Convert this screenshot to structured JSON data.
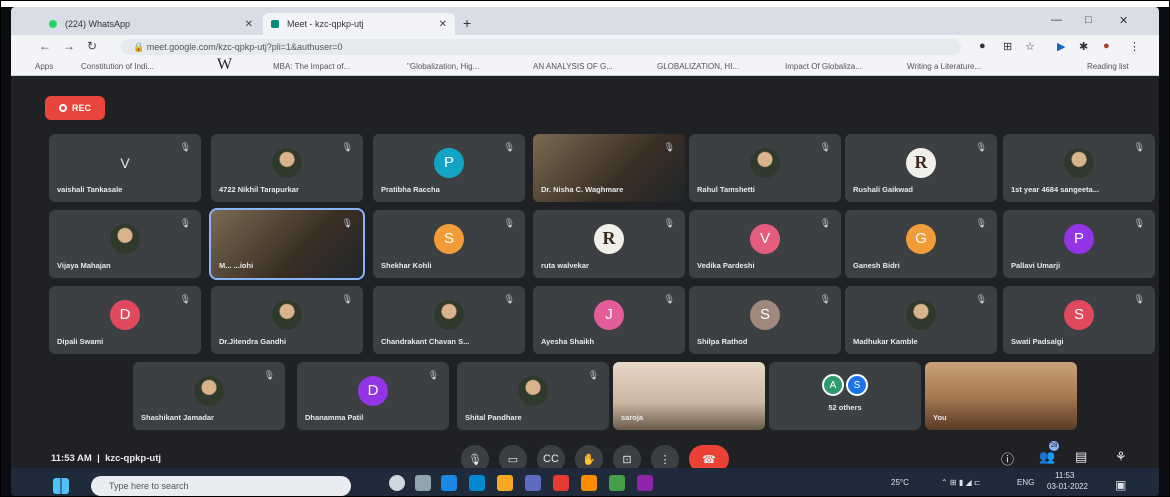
{
  "document_header_text": "",
  "browser": {
    "tabs": [
      {
        "label": "(224) WhatsApp",
        "icon": "whatsapp-icon",
        "color": "#25d366"
      },
      {
        "label": "Meet - kzc-qpkp-utj",
        "icon": "meet-icon",
        "color": "#00897b"
      }
    ],
    "new_tab": "+",
    "window_controls": [
      "—",
      "□",
      "✕"
    ],
    "url": "meet.google.com/kzc-qpkp-utj?pli=1&authuser=0",
    "bookmarks": [
      "Apps",
      "Constitution of Indi...",
      "W",
      "MBA: The Impact of...",
      "\"Globalization, Hig...",
      "AN ANALYSIS OF G...",
      "GLOBALIZATION, HI...",
      "Impact Of Globaliza...",
      "Writing a Literature...",
      "Reading list"
    ]
  },
  "meet": {
    "rec_label": "REC",
    "participants": [
      {
        "name": "vaishali Tankasale",
        "initial": "V",
        "kind": "plain"
      },
      {
        "name": "4722 Nikhil Tarapurkar",
        "initial": "",
        "kind": "photo"
      },
      {
        "name": "Pratibha Raccha",
        "initial": "P",
        "kind": "letter",
        "color": "#12a4c3"
      },
      {
        "name": "Dr. Nisha C. Waghmare",
        "initial": "",
        "kind": "video"
      },
      {
        "name": "Rahul Tamshetti",
        "initial": "",
        "kind": "photo"
      },
      {
        "name": "Rushali Gaikwad",
        "initial": "R",
        "kind": "logo"
      },
      {
        "name": "1st year 4684 sangeeta...",
        "initial": "",
        "kind": "photo"
      },
      {
        "name": "Vijaya Mahajan",
        "initial": "",
        "kind": "photo"
      },
      {
        "name": "M...   ...iohi",
        "initial": "",
        "kind": "video-active"
      },
      {
        "name": "Shekhar Kohli",
        "initial": "S",
        "kind": "letter",
        "color": "#f29c38"
      },
      {
        "name": "ruta walvekar",
        "initial": "R",
        "kind": "logo"
      },
      {
        "name": "Vedika Pardeshi",
        "initial": "V",
        "kind": "letter",
        "color": "#e45d7d"
      },
      {
        "name": "Ganesh Bidri",
        "initial": "G",
        "kind": "letter",
        "color": "#f29c38"
      },
      {
        "name": "Pallavi Umarji",
        "initial": "P",
        "kind": "letter",
        "color": "#9334e6"
      },
      {
        "name": "Dipali Swami",
        "initial": "D",
        "kind": "letter",
        "color": "#e0485e"
      },
      {
        "name": "Dr.Jitendra Gandhi",
        "initial": "",
        "kind": "photo"
      },
      {
        "name": "Chandrakant Chavan S...",
        "initial": "",
        "kind": "photo"
      },
      {
        "name": "Ayesha Shaikh",
        "initial": "J",
        "kind": "letter",
        "color": "#e45d9b"
      },
      {
        "name": "Shilpa Rathod",
        "initial": "S",
        "kind": "letter",
        "color": "#a1887f"
      },
      {
        "name": "Madhukar Kamble",
        "initial": "",
        "kind": "photo"
      },
      {
        "name": "Swati Padsalgi",
        "initial": "S",
        "kind": "letter",
        "color": "#e0485e"
      },
      {
        "name": "Shashikant Jamadar",
        "initial": "",
        "kind": "photo"
      },
      {
        "name": "Dhanamma Patil",
        "initial": "D",
        "kind": "letter",
        "color": "#9334e6"
      },
      {
        "name": "Shital Pandhare",
        "initial": "",
        "kind": "photo"
      },
      {
        "name": "saroja",
        "initial": "",
        "kind": "video-warm"
      },
      {
        "name": "52 others",
        "initial": "A S",
        "kind": "others"
      },
      {
        "name": "You",
        "initial": "",
        "kind": "video-orange"
      }
    ],
    "meeting_time": "11:53 AM",
    "meeting_code": "kzc-qpkp-utj",
    "controls": [
      "mic-icon",
      "camera-icon",
      "captions-icon",
      "raise-hand-icon",
      "present-icon",
      "more-icon"
    ],
    "right_controls": [
      "info-icon",
      "people-icon",
      "chat-icon",
      "activities-icon"
    ],
    "people_count": "28"
  },
  "taskbar": {
    "search_placeholder": "Type here to search",
    "weather": "25°C",
    "lang": "ENG",
    "time": "11:53",
    "date": "03-01-2022"
  }
}
